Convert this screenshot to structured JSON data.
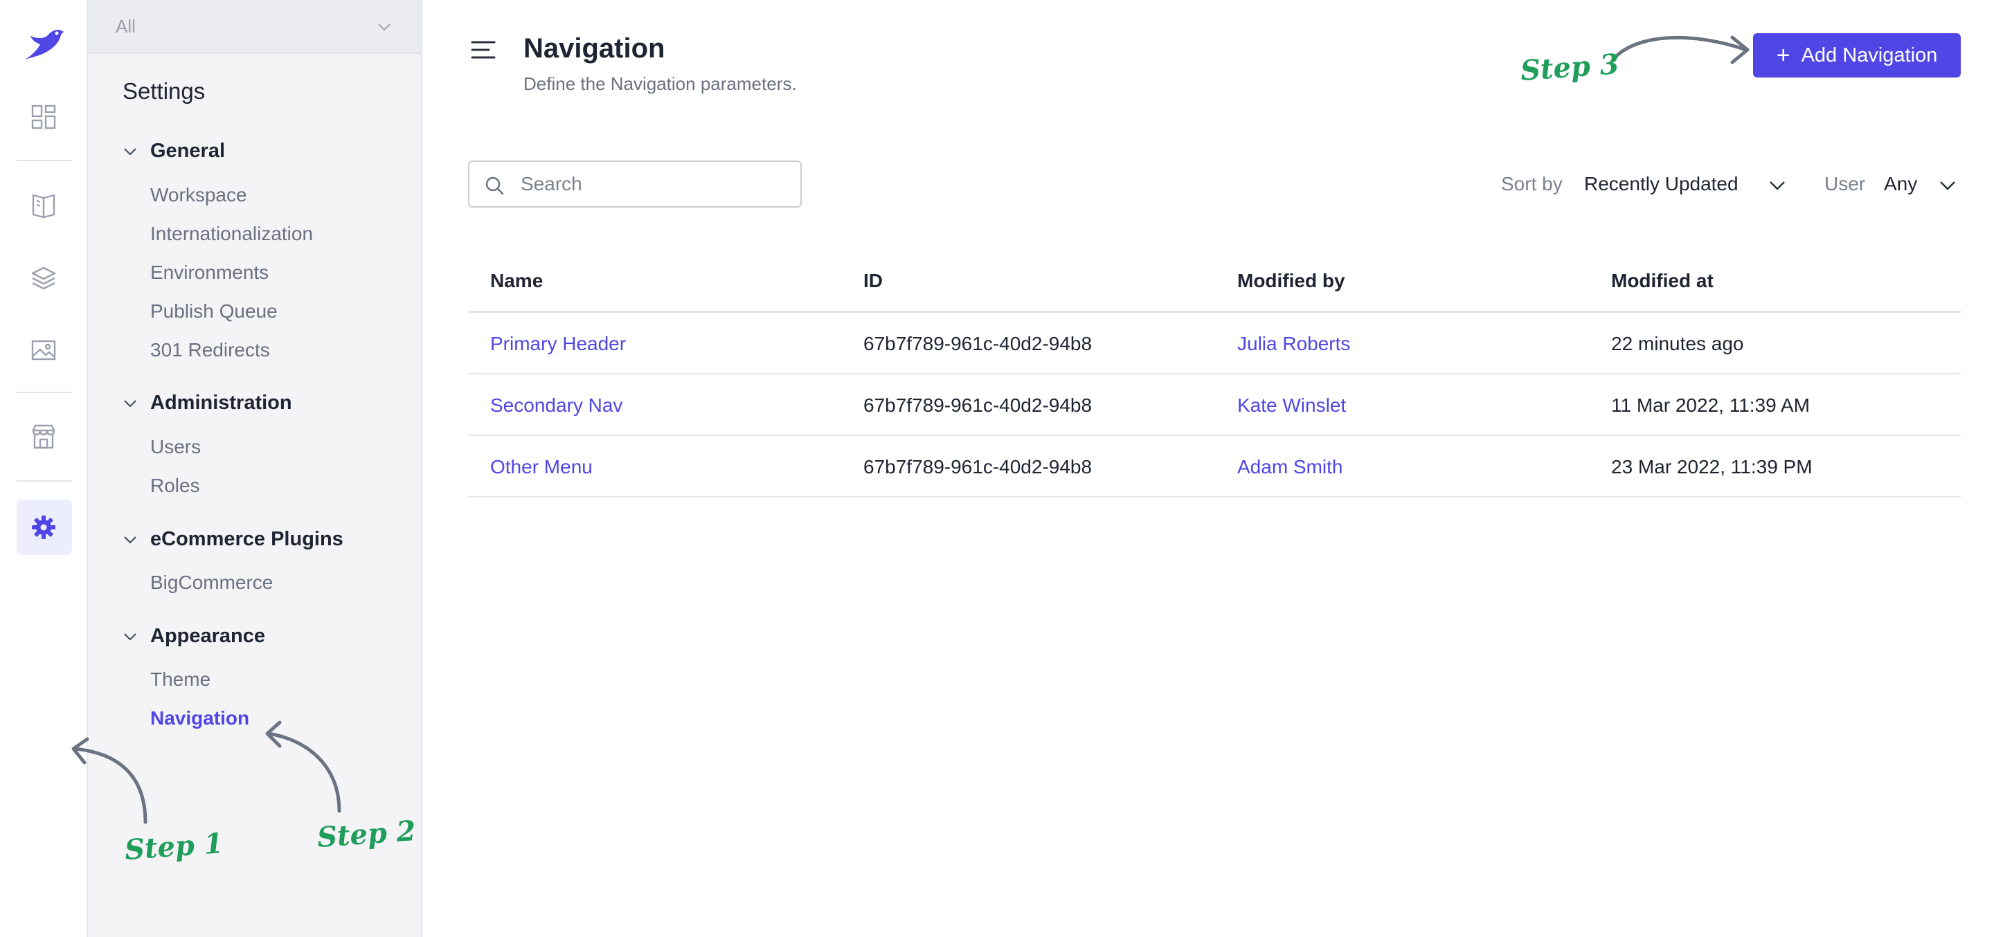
{
  "workspace_selector": {
    "value": "All"
  },
  "settings": {
    "title": "Settings",
    "groups": [
      {
        "label": "General",
        "items": [
          "Workspace",
          "Internationalization",
          "Environments",
          "Publish Queue",
          "301 Redirects"
        ]
      },
      {
        "label": "Administration",
        "items": [
          "Users",
          "Roles"
        ]
      },
      {
        "label": "eCommerce Plugins",
        "items": [
          "BigCommerce"
        ]
      },
      {
        "label": "Appearance",
        "items": [
          "Theme",
          "Navigation"
        ]
      }
    ]
  },
  "rail": {
    "icons": [
      "logo-bird-icon",
      "dashboard-icon",
      "book-icon",
      "layers-icon",
      "image-icon",
      "store-icon",
      "gear-icon"
    ],
    "active": "gear-icon"
  },
  "header": {
    "title": "Navigation",
    "subtitle": "Define the Navigation parameters.",
    "add_button": "Add Navigation"
  },
  "toolbar": {
    "search_placeholder": "Search",
    "sort_label": "Sort by",
    "sort_value": "Recently Updated",
    "user_label": "User",
    "user_value": "Any"
  },
  "table": {
    "columns": [
      "Name",
      "ID",
      "Modified by",
      "Modified at"
    ],
    "rows": [
      {
        "name": "Primary Header",
        "id": "67b7f789-961c-40d2-94b8",
        "modified_by": "Julia Roberts",
        "modified_at": "22 minutes ago"
      },
      {
        "name": "Secondary Nav",
        "id": "67b7f789-961c-40d2-94b8",
        "modified_by": "Kate Winslet",
        "modified_at": "11 Mar 2022, 11:39 AM"
      },
      {
        "name": "Other Menu",
        "id": "67b7f789-961c-40d2-94b8",
        "modified_by": "Adam Smith",
        "modified_at": "23 Mar 2022, 11:39 PM"
      }
    ]
  },
  "annotations": {
    "step1": "Step 1",
    "step2": "Step 2",
    "step3": "Step 3"
  },
  "colors": {
    "accent": "#4f46e5",
    "annotation": "#1e9e5a",
    "arrow": "#6b7280"
  }
}
